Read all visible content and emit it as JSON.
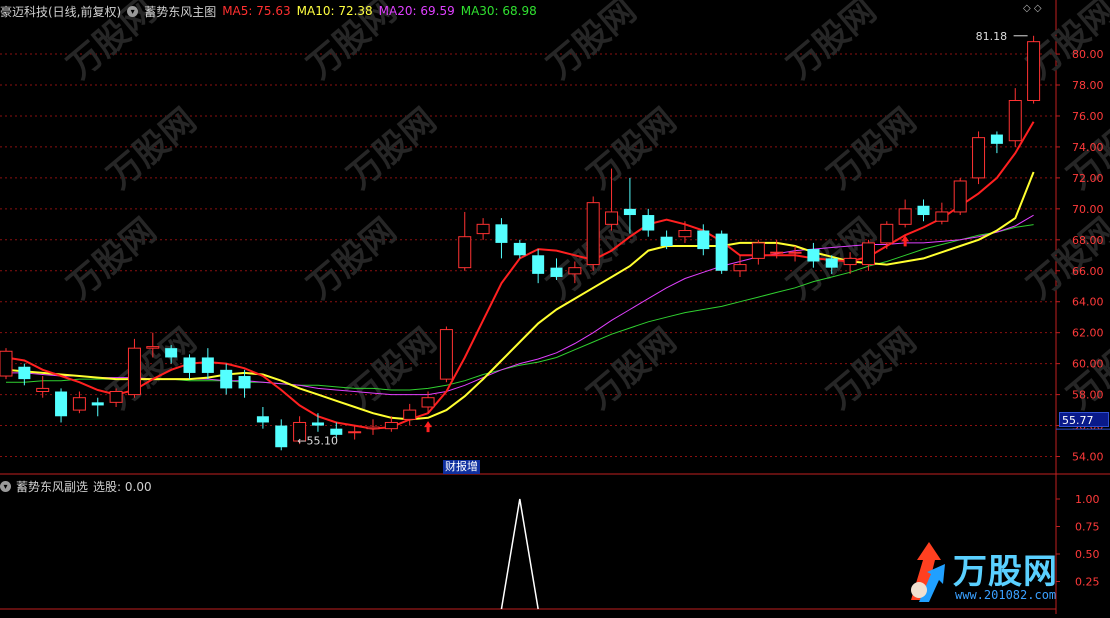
{
  "header": {
    "stock": "豪迈科技(日线,前复权)",
    "main_indicator": "蓄势东风主图",
    "ma5_label": "MA5: 75.63",
    "ma10_label": "MA10: 72.38",
    "ma20_label": "MA20: 69.59",
    "ma30_label": "MA30: 68.98"
  },
  "sub_panel": {
    "name": "蓄势东风副选",
    "value_label": "选股: 0.00"
  },
  "annotations": {
    "high": "81.18",
    "low": "55.10",
    "event": "财报增",
    "current_price": "55.77"
  },
  "watermark": {
    "brand": "万股网",
    "url": "www.201082.com"
  },
  "colors": {
    "up": "#ff3232",
    "down": "#54ffff",
    "ma5": "#ff2020",
    "ma10": "#ffff30",
    "ma20": "#e040ff",
    "ma30": "#30d030",
    "grid": "#8a1010",
    "axis": "#c02020"
  },
  "chart_data": [
    {
      "type": "candlestick",
      "y_ticks": [
        "80.00",
        "78.00",
        "76.00",
        "74.00",
        "72.00",
        "70.00",
        "68.00",
        "66.00",
        "64.00",
        "62.00",
        "60.00",
        "58.00",
        "56.00",
        "54.00"
      ],
      "ylim": [
        53.0,
        82.2
      ],
      "candles": [
        {
          "o": 59.2,
          "c": 60.8,
          "h": 61.0,
          "l": 59.0
        },
        {
          "o": 59.8,
          "c": 59.0,
          "h": 60.0,
          "l": 58.6
        },
        {
          "o": 58.2,
          "c": 58.4,
          "h": 59.2,
          "l": 57.8
        },
        {
          "o": 58.2,
          "c": 56.6,
          "h": 58.4,
          "l": 56.2
        },
        {
          "o": 57.0,
          "c": 57.8,
          "h": 58.2,
          "l": 56.8
        },
        {
          "o": 57.5,
          "c": 57.3,
          "h": 57.8,
          "l": 56.6
        },
        {
          "o": 57.5,
          "c": 58.2,
          "h": 58.4,
          "l": 57.2
        },
        {
          "o": 58.0,
          "c": 61.0,
          "h": 61.6,
          "l": 57.8
        },
        {
          "o": 61.0,
          "c": 61.1,
          "h": 62.0,
          "l": 60.4
        },
        {
          "o": 61.0,
          "c": 60.4,
          "h": 61.2,
          "l": 60.0
        },
        {
          "o": 60.4,
          "c": 59.4,
          "h": 60.6,
          "l": 59.0
        },
        {
          "o": 60.4,
          "c": 59.4,
          "h": 61.0,
          "l": 59.0
        },
        {
          "o": 59.6,
          "c": 58.4,
          "h": 60.0,
          "l": 58.0
        },
        {
          "o": 59.2,
          "c": 58.4,
          "h": 59.6,
          "l": 57.8
        },
        {
          "o": 56.6,
          "c": 56.2,
          "h": 57.2,
          "l": 55.8
        },
        {
          "o": 56.0,
          "c": 54.6,
          "h": 56.4,
          "l": 54.4
        },
        {
          "o": 55.0,
          "c": 56.2,
          "h": 56.6,
          "l": 54.8
        },
        {
          "o": 56.2,
          "c": 56.0,
          "h": 56.8,
          "l": 55.6
        },
        {
          "o": 55.8,
          "c": 55.4,
          "h": 56.2,
          "l": 55.2
        },
        {
          "o": 55.6,
          "c": 55.6,
          "h": 56.0,
          "l": 55.1
        },
        {
          "o": 55.8,
          "c": 55.9,
          "h": 56.4,
          "l": 55.4
        },
        {
          "o": 55.8,
          "c": 56.2,
          "h": 56.6,
          "l": 55.6
        },
        {
          "o": 56.4,
          "c": 57.0,
          "h": 57.4,
          "l": 56.0
        },
        {
          "o": 57.2,
          "c": 57.8,
          "h": 58.2,
          "l": 56.8
        },
        {
          "o": 59.0,
          "c": 62.2,
          "h": 62.4,
          "l": 58.8
        },
        {
          "o": 66.2,
          "c": 68.2,
          "h": 69.8,
          "l": 66.0
        },
        {
          "o": 68.4,
          "c": 69.0,
          "h": 69.4,
          "l": 68.0
        },
        {
          "o": 69.0,
          "c": 67.8,
          "h": 69.4,
          "l": 66.8
        },
        {
          "o": 67.8,
          "c": 67.0,
          "h": 68.0,
          "l": 66.8
        },
        {
          "o": 67.0,
          "c": 65.8,
          "h": 67.4,
          "l": 65.2
        },
        {
          "o": 66.2,
          "c": 65.6,
          "h": 66.8,
          "l": 65.4
        },
        {
          "o": 65.8,
          "c": 66.2,
          "h": 66.6,
          "l": 65.2
        },
        {
          "o": 66.4,
          "c": 70.4,
          "h": 70.8,
          "l": 66.0
        },
        {
          "o": 69.0,
          "c": 69.8,
          "h": 72.6,
          "l": 68.6
        },
        {
          "o": 70.0,
          "c": 69.6,
          "h": 72.0,
          "l": 68.4
        },
        {
          "o": 69.6,
          "c": 68.6,
          "h": 70.0,
          "l": 68.2
        },
        {
          "o": 68.2,
          "c": 67.6,
          "h": 68.6,
          "l": 67.4
        },
        {
          "o": 68.2,
          "c": 68.6,
          "h": 69.2,
          "l": 67.8
        },
        {
          "o": 68.6,
          "c": 67.4,
          "h": 69.0,
          "l": 67.0
        },
        {
          "o": 68.4,
          "c": 66.0,
          "h": 68.6,
          "l": 65.8
        },
        {
          "o": 66.0,
          "c": 66.4,
          "h": 67.0,
          "l": 65.6
        },
        {
          "o": 66.8,
          "c": 67.8,
          "h": 68.0,
          "l": 66.4
        },
        {
          "o": 67.2,
          "c": 67.2,
          "h": 68.0,
          "l": 66.8
        },
        {
          "o": 67.2,
          "c": 67.2,
          "h": 67.6,
          "l": 66.6
        },
        {
          "o": 67.4,
          "c": 66.6,
          "h": 67.8,
          "l": 66.2
        },
        {
          "o": 66.8,
          "c": 66.2,
          "h": 67.0,
          "l": 65.8
        },
        {
          "o": 66.4,
          "c": 66.8,
          "h": 67.2,
          "l": 65.8
        },
        {
          "o": 66.4,
          "c": 67.8,
          "h": 68.0,
          "l": 66.0
        },
        {
          "o": 67.8,
          "c": 69.0,
          "h": 69.2,
          "l": 67.4
        },
        {
          "o": 69.0,
          "c": 70.0,
          "h": 70.6,
          "l": 68.8
        },
        {
          "o": 70.2,
          "c": 69.6,
          "h": 70.6,
          "l": 69.2
        },
        {
          "o": 69.2,
          "c": 69.8,
          "h": 70.4,
          "l": 69.0
        },
        {
          "o": 69.8,
          "c": 71.8,
          "h": 72.0,
          "l": 69.6
        },
        {
          "o": 72.0,
          "c": 74.6,
          "h": 75.0,
          "l": 71.6
        },
        {
          "o": 74.8,
          "c": 74.2,
          "h": 75.0,
          "l": 73.6
        },
        {
          "o": 74.4,
          "c": 77.0,
          "h": 77.8,
          "l": 74.0
        },
        {
          "o": 77.0,
          "c": 80.8,
          "h": 81.18,
          "l": 76.8
        }
      ],
      "ma5": [
        60.4,
        60.2,
        59.6,
        59.2,
        58.8,
        58.3,
        58.0,
        58.3,
        59.0,
        59.6,
        60.0,
        60.1,
        60.0,
        59.7,
        59.2,
        58.3,
        57.3,
        56.6,
        56.2,
        56.0,
        55.8,
        55.9,
        56.4,
        56.8,
        58.2,
        60.4,
        62.8,
        65.2,
        66.8,
        67.4,
        67.3,
        67.0,
        66.7,
        67.3,
        68.2,
        69.0,
        69.3,
        69.0,
        68.6,
        67.9,
        67.0,
        67.0,
        67.0,
        67.0,
        66.8,
        66.7,
        66.6,
        66.9,
        67.6,
        68.3,
        68.8,
        69.4,
        70.2,
        71.0,
        72.0,
        73.6,
        75.63
      ],
      "ma10": [
        59.6,
        59.5,
        59.4,
        59.3,
        59.2,
        59.1,
        59.0,
        59.0,
        59.0,
        59.0,
        59.0,
        59.1,
        59.3,
        59.4,
        59.3,
        58.9,
        58.4,
        58.0,
        57.6,
        57.2,
        56.8,
        56.5,
        56.4,
        56.5,
        57.0,
        57.9,
        59.0,
        60.2,
        61.4,
        62.6,
        63.5,
        64.2,
        64.9,
        65.6,
        66.3,
        67.3,
        67.6,
        67.6,
        67.6,
        67.6,
        67.8,
        67.8,
        67.8,
        67.6,
        67.2,
        66.9,
        66.6,
        66.5,
        66.4,
        66.6,
        66.8,
        67.2,
        67.6,
        68.0,
        68.6,
        69.4,
        72.38
      ],
      "ma20": [
        59.4,
        59.4,
        59.3,
        59.2,
        59.2,
        59.1,
        59.1,
        59.1,
        59.0,
        59.0,
        59.0,
        59.0,
        58.9,
        58.9,
        58.8,
        58.7,
        58.6,
        58.4,
        58.3,
        58.2,
        58.1,
        58.0,
        58.0,
        58.0,
        58.2,
        58.6,
        59.1,
        59.6,
        60.0,
        60.3,
        60.7,
        61.3,
        62.0,
        62.8,
        63.5,
        64.2,
        64.9,
        65.5,
        65.9,
        66.3,
        66.6,
        66.9,
        67.1,
        67.3,
        67.4,
        67.5,
        67.6,
        67.7,
        67.7,
        67.8,
        67.8,
        67.9,
        68.0,
        68.2,
        68.5,
        68.9,
        69.59
      ],
      "ma30": [
        58.8,
        58.8,
        58.9,
        58.9,
        59.0,
        59.0,
        59.0,
        59.0,
        59.0,
        59.0,
        58.9,
        58.9,
        58.9,
        58.8,
        58.8,
        58.7,
        58.6,
        58.6,
        58.5,
        58.4,
        58.4,
        58.3,
        58.3,
        58.4,
        58.6,
        58.9,
        59.3,
        59.6,
        59.9,
        60.1,
        60.4,
        60.9,
        61.4,
        61.9,
        62.3,
        62.7,
        63.0,
        63.3,
        63.5,
        63.7,
        64.0,
        64.3,
        64.6,
        64.9,
        65.3,
        65.6,
        65.9,
        66.3,
        66.6,
        67.0,
        67.4,
        67.7,
        68.0,
        68.3,
        68.5,
        68.8,
        68.98
      ]
    },
    {
      "type": "line",
      "y_ticks": [
        "1.00",
        "0.75",
        "0.50",
        "0.25"
      ],
      "ylim": [
        0,
        1.1
      ],
      "series": [
        {
          "values": [
            0,
            0,
            0,
            0,
            0,
            0,
            0,
            0,
            0,
            0,
            0,
            0,
            0,
            0,
            0,
            0,
            0,
            0,
            0,
            0,
            0,
            0,
            0,
            0,
            0,
            0,
            0,
            0,
            1,
            0,
            0,
            0,
            0,
            0,
            0,
            0,
            0,
            0,
            0,
            0,
            0,
            0,
            0,
            0,
            0,
            0,
            0,
            0,
            0,
            0,
            0,
            0,
            0,
            0,
            0,
            0,
            0
          ]
        }
      ]
    }
  ]
}
